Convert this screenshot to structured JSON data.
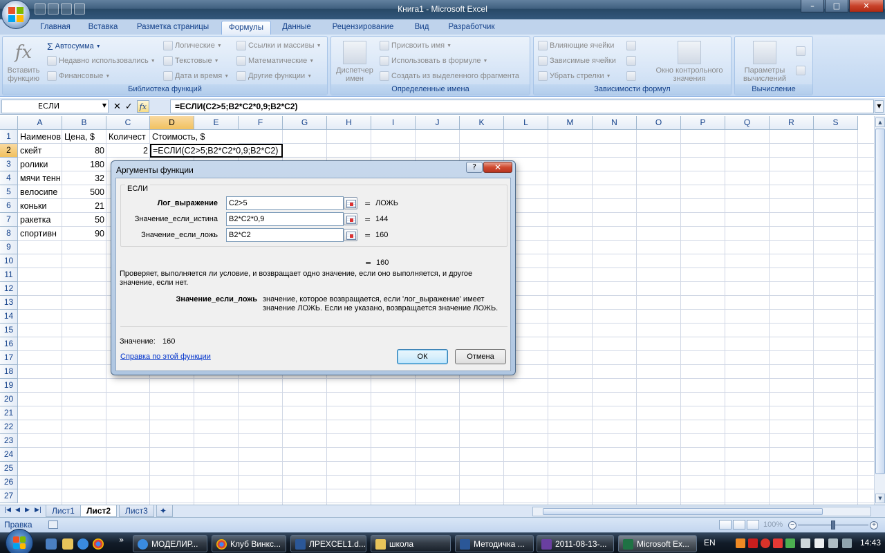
{
  "window": {
    "title": "Книга1 - Microsoft Excel",
    "min": "–",
    "max": "□",
    "close": "✕"
  },
  "ribbon_tabs": [
    "Главная",
    "Вставка",
    "Разметка страницы",
    "Формулы",
    "Данные",
    "Рецензирование",
    "Вид",
    "Разработчик"
  ],
  "active_tab": "Формулы",
  "ribbon": {
    "library": {
      "label": "Библиотека функций",
      "insert_function": [
        "Вставить",
        "функцию"
      ],
      "autosum": "Автосумма",
      "recent": "Недавно использовались",
      "financial": "Финансовые",
      "logical": "Логические",
      "text": "Текстовые",
      "datetime": "Дата и время",
      "lookup": "Ссылки и массивы",
      "math": "Математические",
      "other": "Другие функции"
    },
    "names": {
      "label": "Определенные имена",
      "manager": [
        "Диспетчер",
        "имен"
      ],
      "define": "Присвоить имя",
      "use": "Использовать в формуле",
      "create": "Создать из выделенного фрагмента"
    },
    "audit": {
      "label": "Зависимости формул",
      "precedents": "Влияющие ячейки",
      "dependents": "Зависимые ячейки",
      "remove": "Убрать стрелки",
      "watch": [
        "Окно контрольного",
        "значения"
      ]
    },
    "calc": {
      "label": "Вычисление",
      "options": [
        "Параметры",
        "вычислений"
      ]
    }
  },
  "formula_bar": {
    "name_box": "ЕСЛИ",
    "formula": "=ЕСЛИ(C2>5;B2*C2*0,9;B2*C2)",
    "cancel": "✕",
    "enter": "✓",
    "fx": "fx"
  },
  "columns": [
    "A",
    "B",
    "C",
    "D",
    "E",
    "F",
    "G",
    "H",
    "I",
    "J",
    "K",
    "L",
    "M",
    "N",
    "O",
    "P",
    "Q",
    "R",
    "S"
  ],
  "rows": [
    "1",
    "2",
    "3",
    "4",
    "5",
    "6",
    "7",
    "8",
    "9",
    "10",
    "11",
    "12",
    "13",
    "14",
    "15",
    "16",
    "17",
    "18",
    "19",
    "20",
    "21",
    "22",
    "23",
    "24",
    "25",
    "26",
    "27"
  ],
  "cells": {
    "A1": "Наименов",
    "B1": "Цена, $",
    "C1": "Количест",
    "D1": "Стоимость, $",
    "A2": "скейт",
    "B2": "80",
    "C2": "2",
    "A3": "ролики",
    "B3": "180",
    "A4": "мячи тенн",
    "B4": "32",
    "A5": "велосипе",
    "B5": "500",
    "A6": "коньки",
    "B6": "21",
    "A7": "ракетка",
    "B7": "50",
    "A8": "спортивн",
    "B8": "90"
  },
  "active_cell_text": "=ЕСЛИ(C2>5;B2*C2*0,9;B2*C2)",
  "sheets": [
    "Лист1",
    "Лист2",
    "Лист3"
  ],
  "active_sheet": "Лист2",
  "status": {
    "ready": "Правка",
    "zoom": "100%"
  },
  "dialog": {
    "title": "Аргументы функции",
    "help": "?",
    "close": "✕",
    "function": "ЕСЛИ",
    "args": [
      {
        "label": "Лог_выражение",
        "value": "C2>5",
        "result": "ЛОЖЬ"
      },
      {
        "label": "Значение_если_истина",
        "value": "B2*C2*0,9",
        "result": "144"
      },
      {
        "label": "Значение_если_ложь",
        "value": "B2*C2",
        "result": "160"
      }
    ],
    "eq": "=",
    "total_result": "160",
    "description_1": "Проверяет, выполняется ли условие, и возвращает одно значение, если оно выполняется, и другое",
    "description_2": "значение, если нет.",
    "arg_name": "Значение_если_ложь",
    "arg_help_1": "значение, которое возвращается, если 'лог_выражение' имеет",
    "arg_help_2": "значение ЛОЖЬ. Если не указано, возвращается значение ЛОЖЬ.",
    "value_label": "Значение:",
    "value": "160",
    "help_link": "Справка по этой функции",
    "ok": "ОК",
    "cancel": "Отмена"
  },
  "taskbar": {
    "tasks": [
      "МОДЕЛИР...",
      "Клуб Винкс...",
      "ЛРEXCEL1.d...",
      "школа",
      "Методичка ...",
      "2011-08-13-...",
      "Microsoft Ex..."
    ],
    "lang": "EN",
    "clock": "14:43"
  }
}
